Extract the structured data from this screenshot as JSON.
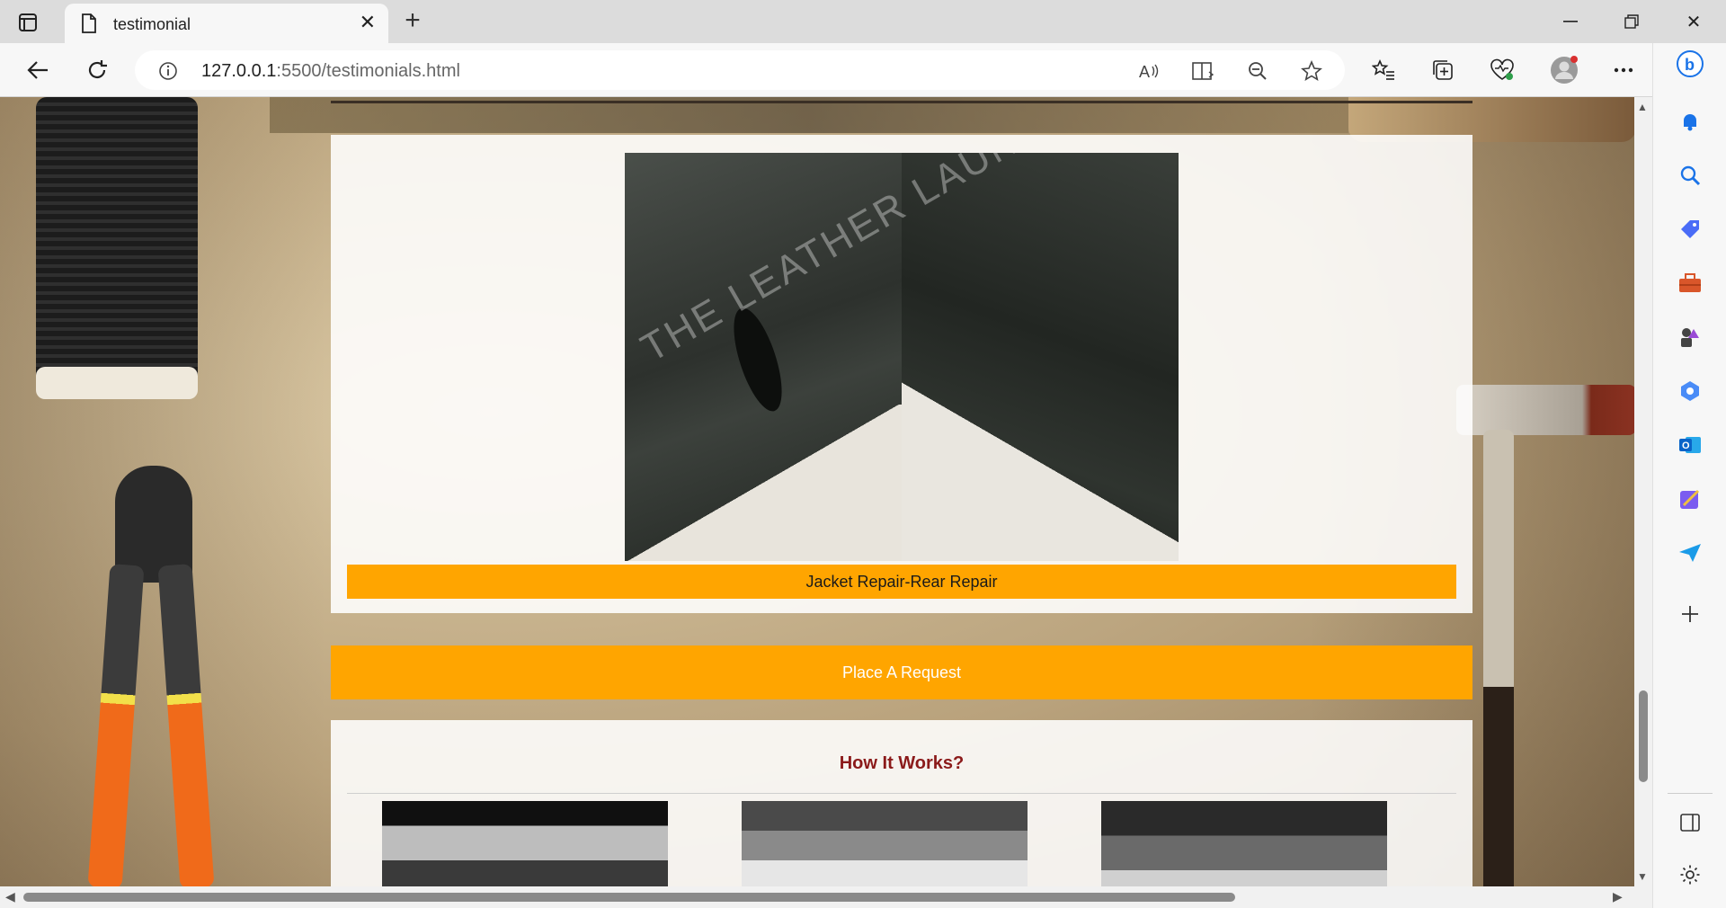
{
  "browser": {
    "tab_title": "testimonial",
    "url_host": "127.0.0.1",
    "url_path": ":5500/testimonials.html"
  },
  "page": {
    "photo_watermark": "THE LEATHER LAUNDRY",
    "testimonial_caption": "Jacket Repair-Rear Repair",
    "request_button": "Place A Request",
    "how_it_works_title": "How It Works?"
  },
  "colors": {
    "accent_orange": "#ffa500",
    "heading_red": "#8b1a1a"
  },
  "icons": {
    "tab_actions": "tab-actions-icon",
    "favicon": "page-icon",
    "sidebar": [
      "bell-icon",
      "search-icon",
      "shopping-tag-icon",
      "toolbox-icon",
      "games-icon",
      "office-icon",
      "outlook-icon",
      "designer-icon",
      "send-icon",
      "add-icon",
      "sidebar-layout-icon",
      "settings-icon"
    ]
  }
}
